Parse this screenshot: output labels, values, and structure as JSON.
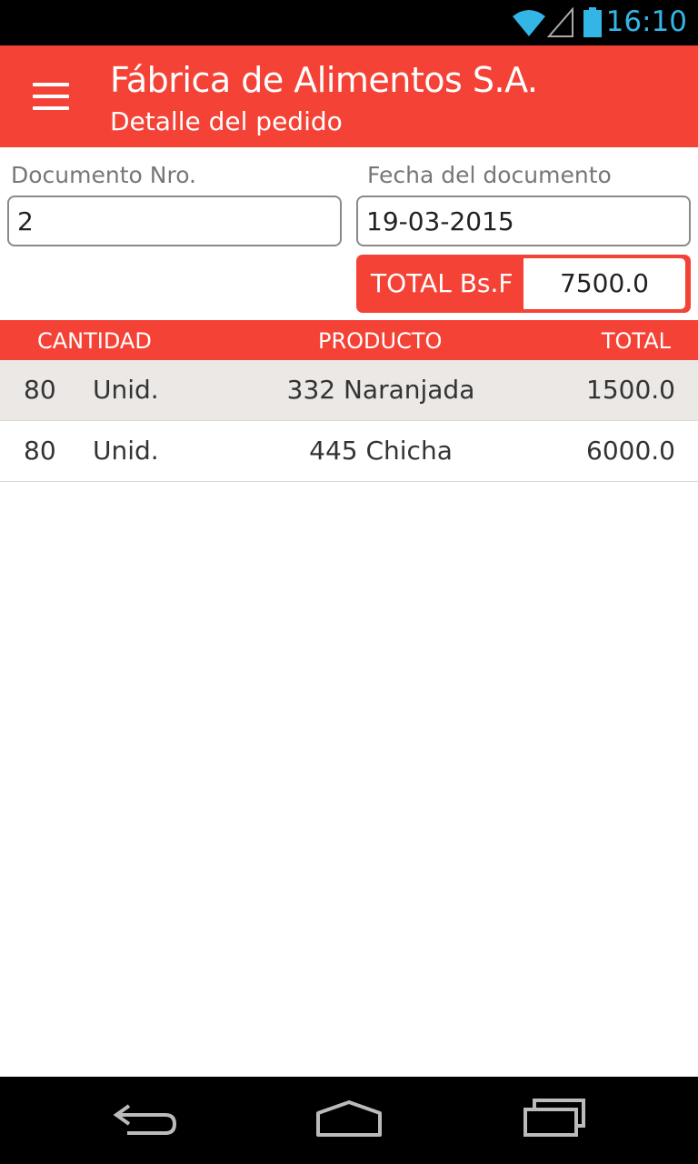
{
  "status": {
    "time": "16:10"
  },
  "header": {
    "title": "Fábrica de Alimentos S.A.",
    "subtitle": "Detalle del pedido"
  },
  "form": {
    "doc_label": "Documento Nro.",
    "doc_value": "2",
    "date_label": "Fecha del documento",
    "date_value": "19-03-2015",
    "total_label": "TOTAL Bs.F",
    "total_value": "7500.0"
  },
  "table": {
    "headers": [
      "CANTIDAD",
      "PRODUCTO",
      "TOTAL"
    ],
    "rows": [
      {
        "qty": "80",
        "unit": "Unid.",
        "product": "332 Naranjada",
        "total": "1500.0"
      },
      {
        "qty": "80",
        "unit": "Unid.",
        "product": "445 Chicha",
        "total": "6000.0"
      }
    ]
  },
  "colors": {
    "primary": "#f44336",
    "status_text": "#33b5e5",
    "row_alt": "#ebe8e6"
  },
  "icons": [
    "menu-icon",
    "wifi-icon",
    "signal-icon",
    "battery-icon",
    "back-icon",
    "home-icon",
    "recents-icon"
  ]
}
